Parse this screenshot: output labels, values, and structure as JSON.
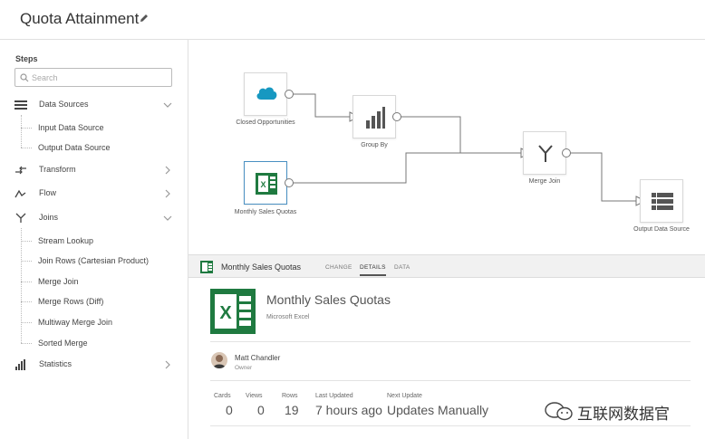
{
  "header": {
    "title": "Quota Attainment"
  },
  "sidebar": {
    "steps_label": "Steps",
    "search_placeholder": "Search",
    "categories": {
      "data_sources": {
        "label": "Data Sources",
        "items": [
          "Input Data Source",
          "Output Data Source"
        ]
      },
      "transform": {
        "label": "Transform"
      },
      "flow": {
        "label": "Flow"
      },
      "joins": {
        "label": "Joins",
        "items": [
          "Stream Lookup",
          "Join Rows (Cartesian Product)",
          "Merge Join",
          "Merge Rows (Diff)",
          "Multiway Merge Join",
          "Sorted Merge"
        ]
      },
      "statistics": {
        "label": "Statistics"
      }
    }
  },
  "canvas": {
    "nodes": {
      "closed_opportunities": "Closed Opportunities",
      "group_by": "Group By",
      "monthly_sales_quotas": "Monthly Sales Quotas",
      "merge_join": "Merge Join",
      "output_data_source": "Output Data Source"
    }
  },
  "detail_bar": {
    "title": "Monthly Sales Quotas",
    "tabs": [
      "CHANGE",
      "DETAILS",
      "DATA"
    ],
    "active_tab": "DETAILS"
  },
  "detail": {
    "title": "Monthly Sales Quotas",
    "subtitle": "Microsoft Excel",
    "owner": {
      "name": "Matt Chandler",
      "role": "Owner"
    },
    "stats": [
      {
        "label": "Cards",
        "value": "0"
      },
      {
        "label": "Views",
        "value": "0"
      },
      {
        "label": "Rows",
        "value": "19"
      },
      {
        "label": "Last Updated",
        "value": "7 hours ago"
      },
      {
        "label": "Next Update",
        "value": "Updates Manually"
      }
    ]
  },
  "watermark": {
    "text": "互联网数据官"
  },
  "colors": {
    "salesforce": "#1798c1",
    "excel": "#1f7a40",
    "connector": "#777777",
    "selected_border": "#4a90c2"
  }
}
